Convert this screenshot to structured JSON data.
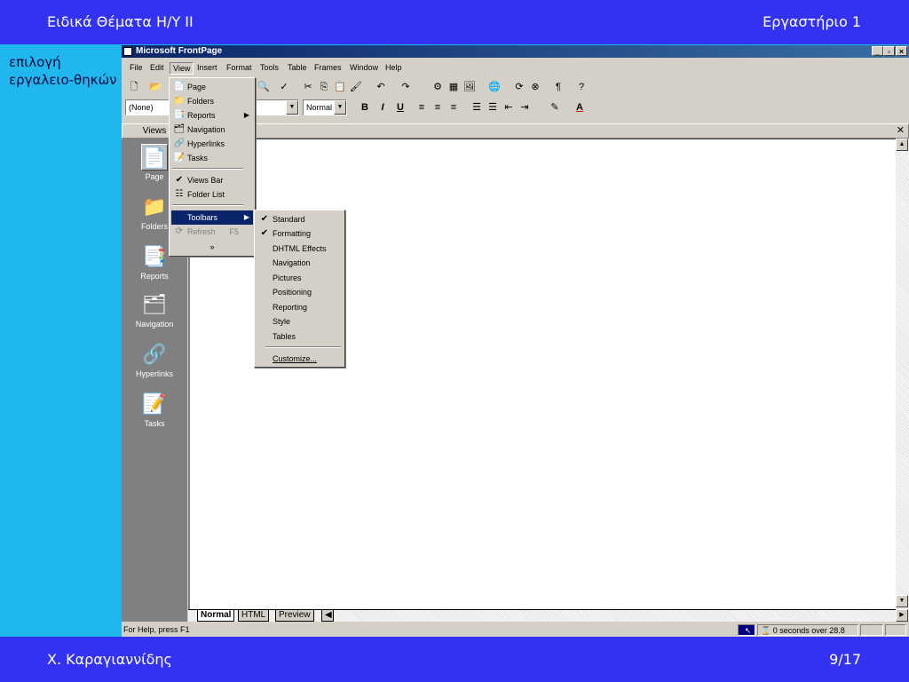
{
  "slide": {
    "header_left": "Ειδικά Θέματα Η/Υ ΙΙ",
    "header_right": "Εργαστήριο 1",
    "side_note": "επιλογή εργαλειο-θηκών",
    "footer_left": "Χ. Καραγιαννίδης",
    "footer_right": "9/17"
  },
  "window": {
    "title": "Microsoft FrontPage",
    "controls": [
      "_",
      "▫",
      "×"
    ]
  },
  "menubar": [
    "File",
    "Edit",
    "View",
    "Insert",
    "Format",
    "Tools",
    "Table",
    "Frames",
    "Window",
    "Help"
  ],
  "toolbar": {
    "style_combo": "(None)",
    "size_combo": "Normal",
    "bold": "B",
    "italic": "I",
    "underline": "U"
  },
  "views": {
    "header": "Views",
    "items": [
      "Page",
      "Folders",
      "Reports",
      "Navigation",
      "Hyperlinks",
      "Tasks"
    ],
    "icons": [
      "page-icon",
      "folder-icon",
      "reports-icon",
      "navigation-icon",
      "hyperlinks-icon",
      "tasks-icon"
    ]
  },
  "doc_header_fragment": "n",
  "view_menu": {
    "items": [
      "Page",
      "Folders",
      "Reports",
      "Navigation",
      "Hyperlinks",
      "Tasks",
      "Views Bar",
      "Folder List",
      "Toolbars",
      "Refresh"
    ],
    "refresh_shortcut": "F5",
    "more": "»"
  },
  "toolbars_menu": {
    "items": [
      "Standard",
      "Formatting",
      "DHTML Effects",
      "Navigation",
      "Pictures",
      "Positioning",
      "Reporting",
      "Style",
      "Tables",
      "Customize..."
    ]
  },
  "tabs": [
    "Normal",
    "HTML",
    "Preview"
  ],
  "status": {
    "help": "For Help, press F1",
    "time": "0 seconds over 28.8"
  }
}
